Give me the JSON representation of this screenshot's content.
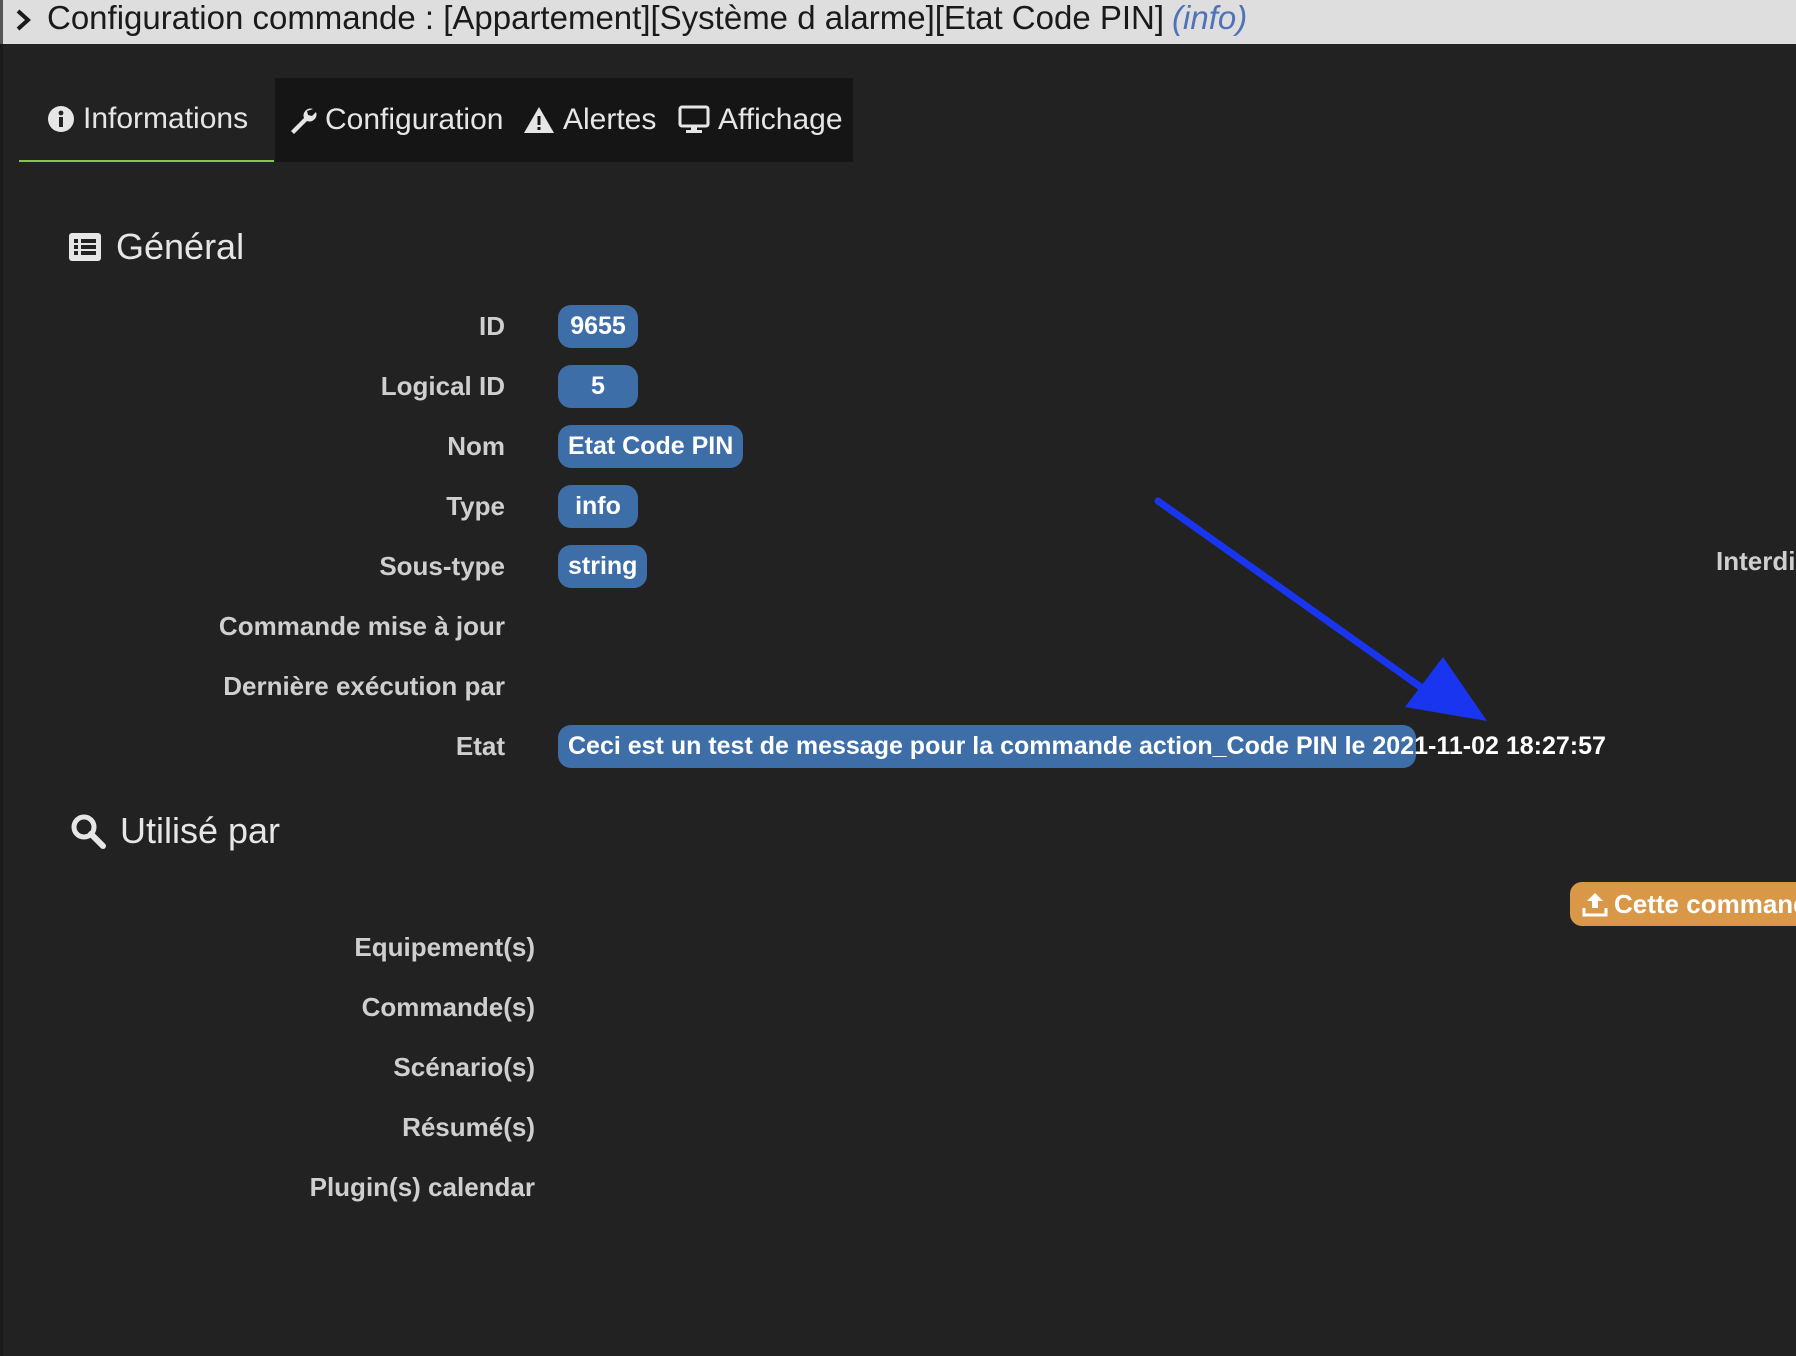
{
  "window": {
    "title": "Configuration commande : [Appartement][Système d alarme][Etat Code PIN]",
    "subtitle": "(info)"
  },
  "tabs": [
    {
      "label": "Informations",
      "icon": "info-circle-icon",
      "active": true
    },
    {
      "label": "Configuration",
      "icon": "wrench-icon",
      "active": false
    },
    {
      "label": "Alertes",
      "icon": "warning-icon",
      "active": false
    },
    {
      "label": "Affichage",
      "icon": "monitor-icon",
      "active": false
    }
  ],
  "general": {
    "heading": "Général",
    "icon": "list-icon",
    "fields": [
      {
        "label": "ID",
        "value": "9655"
      },
      {
        "label": "Logical ID",
        "value": "5"
      },
      {
        "label": "Nom",
        "value": "Etat Code PIN"
      },
      {
        "label": "Type",
        "value": "info"
      },
      {
        "label": "Sous-type",
        "value": "string"
      },
      {
        "label": "Commande mise à jour",
        "value": ""
      },
      {
        "label": "Dernière exécution par",
        "value": ""
      },
      {
        "label": "Etat",
        "value": "Ceci est un test de message pour la commande action_Code PIN le 2021-11-02 18:27:57"
      }
    ],
    "right_label": "Interdir"
  },
  "used_by": {
    "heading": "Utilisé par",
    "icon": "search-icon",
    "rows": [
      "Equipement(s)",
      "Commande(s)",
      "Scénario(s)",
      "Résumé(s)",
      "Plugin(s) calendar"
    ],
    "button_label": "Cette commande"
  },
  "colors": {
    "pill": "#3d6ea8",
    "accent_green": "#8bc34a",
    "orange": "#d99848",
    "annotation_arrow": "#1a35f0",
    "background": "#222222"
  }
}
